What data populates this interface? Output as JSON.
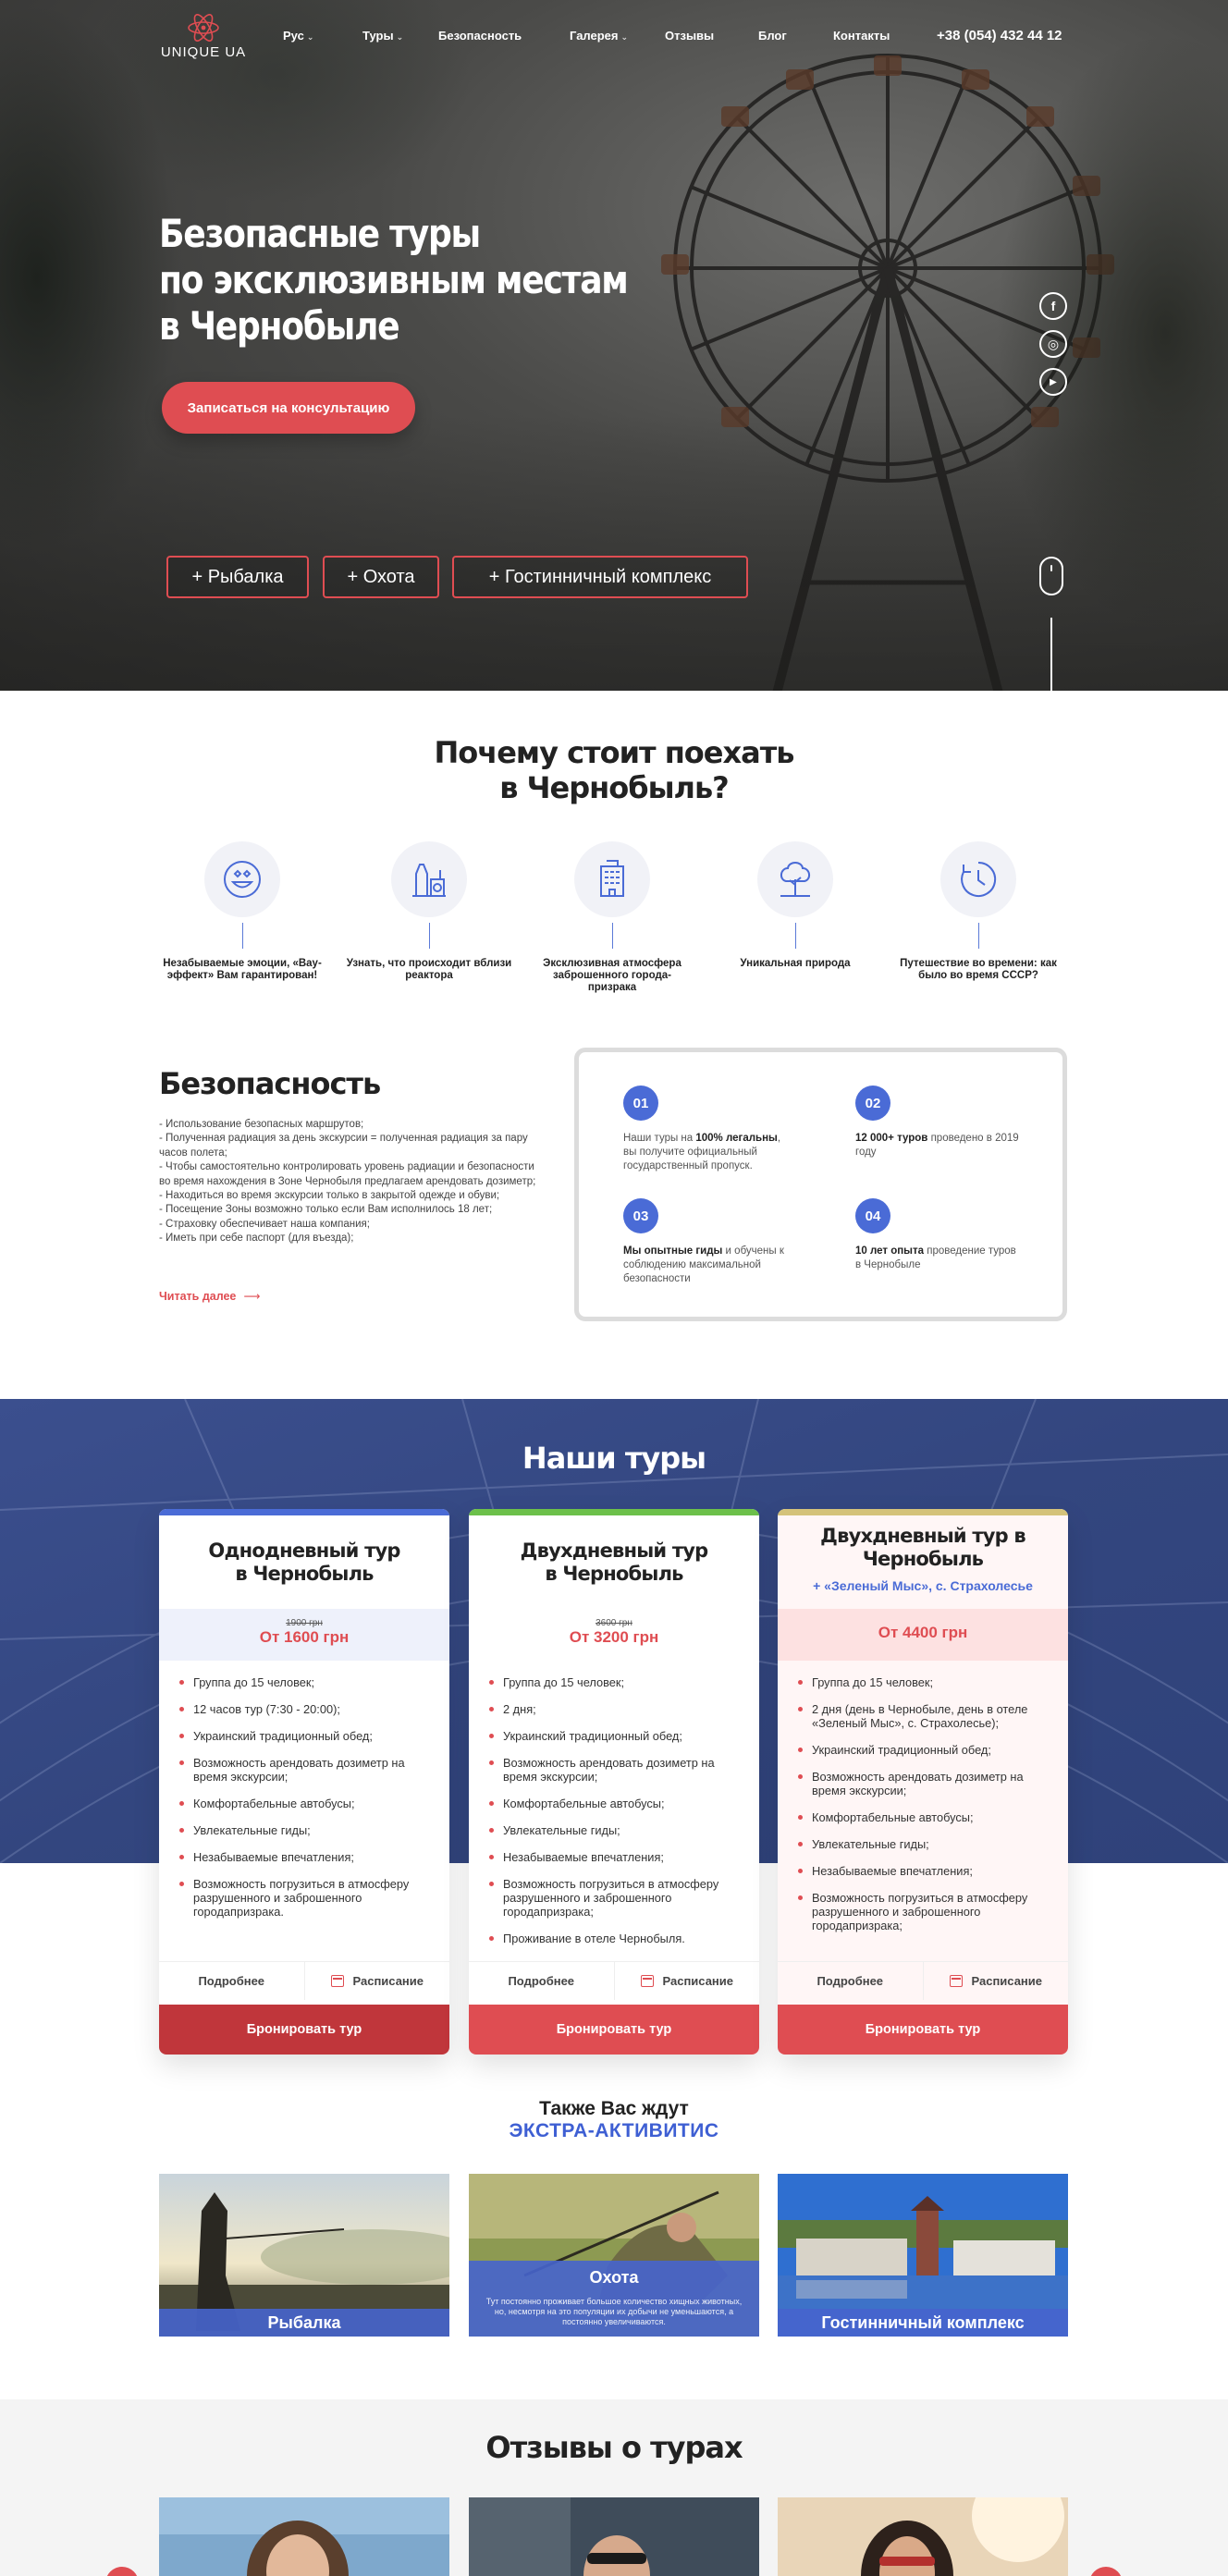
{
  "nav": {
    "logo_text": "UNIQUE UA",
    "items": [
      {
        "label": "Рус",
        "has_caret": true
      },
      {
        "label": "Туры",
        "has_caret": true
      },
      {
        "label": "Безопасность",
        "has_caret": false
      },
      {
        "label": "Галерея",
        "has_caret": true
      },
      {
        "label": "Отзывы",
        "has_caret": false
      },
      {
        "label": "Блог",
        "has_caret": false
      },
      {
        "label": "Контакты",
        "has_caret": false
      }
    ],
    "phone": "+38 (054) 432 44 12"
  },
  "hero": {
    "title_lines": [
      "Безопасные туры",
      "по эксклюзивным местам",
      "в Чернобыле"
    ],
    "cta": "Записаться на консультацию",
    "social": [
      {
        "icon": "facebook-icon",
        "glyph": "f"
      },
      {
        "icon": "instagram-icon",
        "glyph": "◎"
      },
      {
        "icon": "youtube-icon",
        "glyph": "▶"
      }
    ],
    "chips": [
      "+ Рыбалка",
      "+ Охота",
      "+ Гостинничный комплекс"
    ]
  },
  "why": {
    "title_lines": [
      "Почему стоит поехать",
      "в Чернобыль?"
    ],
    "features": [
      {
        "icon": "smile-icon",
        "text": "Незабываемые эмоции, «Вау-эффект» Вам гарантирован!"
      },
      {
        "icon": "reactor-icon",
        "text": "Узнать, что происходит вблизи реактора"
      },
      {
        "icon": "building-icon",
        "text": "Эксклюзивная атмосфера заброшенного города-призрака"
      },
      {
        "icon": "nature-icon",
        "text": "Уникальная природа"
      },
      {
        "icon": "clock-icon",
        "text": "Путешествие во времени: как было во время СССР?"
      }
    ]
  },
  "safety": {
    "title": "Безопасность",
    "list": [
      "- Использование безопасных маршрутов;",
      "- Полученная радиация за день экскурсии = полученная радиация за пару часов полета;",
      "- Чтобы самостоятельно контролировать уровень радиации и безопасности во время нахождения в Зоне Чернобыля предлагаем арендовать дозиметр;",
      "- Находиться во время экскурсии только в закрытой одежде и обуви;",
      "- Посещение Зоны возможно только если Вам исполнилось 18 лет;",
      "- Страховку обеспечивает наша компания;",
      "- Иметь при себе паспорт (для въезда);"
    ],
    "read_more": "Читать далее",
    "facts": [
      {
        "num": "01",
        "pre": "Наши туры на ",
        "bold": "100% легальны",
        "post": ", вы получите официальный государственный пропуск."
      },
      {
        "num": "02",
        "pre": "",
        "bold": "12 000+ туров",
        "post": " проведено в 2019 году"
      },
      {
        "num": "03",
        "pre": "",
        "bold": "Мы опытные гиды",
        "post": " и обучены к соблюдению максимальной безопасности"
      },
      {
        "num": "04",
        "pre": "",
        "bold": "10 лет опыта",
        "post": " проведение туров в Чернобыле"
      }
    ]
  },
  "tours": {
    "title": "Наши туры",
    "details": "Подробнее",
    "schedule": "Расписание",
    "book": "Бронировать тур",
    "cards": [
      {
        "name_lines": [
          "Однодневный тур",
          "в Чернобыль"
        ],
        "subtitle": "",
        "old_price": "1900 грн",
        "price": "От 1600 грн",
        "items": [
          "Группа до 15 человек;",
          "12 часов тур (7:30 - 20:00);",
          "Украинский традиционный обед;",
          "Возможность арендовать дозиметр на время экскурсии;",
          "Комфортабельные автобусы;",
          "Увлекательные гиды;",
          "Незабываемые впечатления;",
          "Возможность погрузиться в атмосферу разрушенного и заброшенного городапризрака."
        ]
      },
      {
        "name_lines": [
          "Двухдневный тур",
          "в Чернобыль"
        ],
        "subtitle": "",
        "old_price": "3600 грн",
        "price": "От 3200 грн",
        "items": [
          "Группа до 15 человек;",
          "2 дня;",
          "Украинский традиционный обед;",
          "Возможность арендовать дозиметр на время экскурсии;",
          "Комфортабельные автобусы;",
          "Увлекательные гиды;",
          "Незабываемые впечатления;",
          "Возможность погрузиться в атмосферу разрушенного и заброшенного городапризрака;",
          "Проживание в отеле Чернобыля."
        ]
      },
      {
        "name_lines": [
          "Двухдневный тур в",
          "Чернобыль"
        ],
        "subtitle": "+ «Зеленый Мыс», с. Страхолесье",
        "old_price": "",
        "price": "От 4400 грн",
        "items": [
          "Группа до 15 человек;",
          "2 дня (день в Чернобыле, день в отеле «Зеленый Мыс», с. Страхолесье);",
          "Украинский традиционный обед;",
          "Возможность арендовать дозиметр на время экскурсии;",
          "Комфортабельные автобусы;",
          "Увлекательные гиды;",
          "Незабываемые впечатления;",
          "Возможность погрузиться в атмосферу разрушенного и заброшенного городапризрака;"
        ]
      }
    ]
  },
  "extra": {
    "line1": "Также Вас ждут",
    "line2": "ЭКСТРА-АКТИВИТИС",
    "items": [
      {
        "title": "Рыбалка"
      },
      {
        "title": "Охота",
        "desc": "Тут постоянно проживает большое количество хищных животных, но, несмотря на это популяции их добычи не уменьшаются, а постоянно увеличиваются."
      },
      {
        "title": "Гостинничный комплекс"
      }
    ]
  },
  "reviews": {
    "title": "Отзывы о турах"
  },
  "colors": {
    "accent": "#df4d52",
    "blue": "#4a6bd6",
    "tours_bg": "#34477f",
    "bar_blue": "#4a6bd6",
    "bar_green": "#6cc04a",
    "bar_gold": "#d4c27a"
  }
}
